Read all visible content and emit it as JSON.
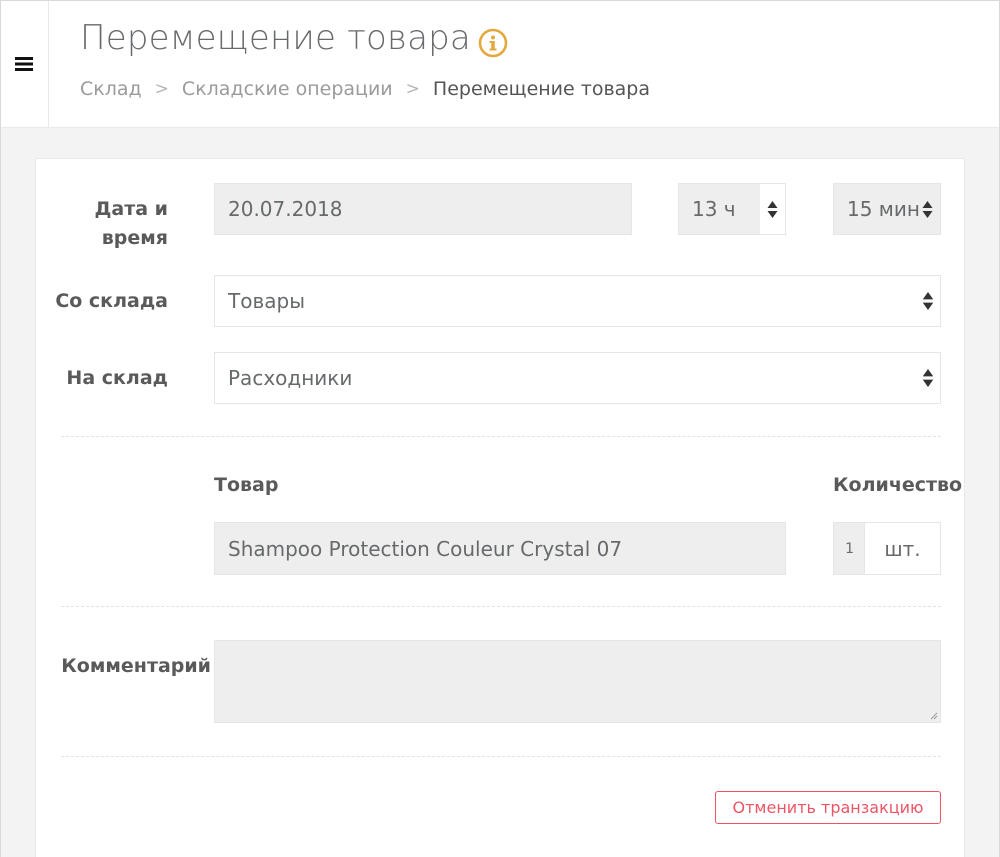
{
  "header": {
    "title": "Перемещение товара",
    "info_icon": "info-circle-icon",
    "menu_icon": "hamburger-menu-icon",
    "breadcrumb": [
      {
        "label": "Склад"
      },
      {
        "label": "Складские операции"
      },
      {
        "label": "Перемещение товара"
      }
    ],
    "breadcrumb_separator": ">"
  },
  "form": {
    "datetime": {
      "label_line1": "Дата и",
      "label_line2": "время",
      "date_value": "20.07.2018",
      "hour_value": "13 ч",
      "minute_value": "15 мин"
    },
    "from_warehouse": {
      "label": "Со склада",
      "value": "Товары"
    },
    "to_warehouse": {
      "label": "На склад",
      "value": "Расходники"
    },
    "items": {
      "product_header": "Товар",
      "quantity_header": "Количество",
      "product_value": "Shampoo Protection Couleur Crystal 07",
      "quantity_value": "1",
      "quantity_unit": "шт."
    },
    "comment": {
      "label": "Комментарий",
      "value": ""
    },
    "cancel_button": "Отменить транзакцию"
  },
  "colors": {
    "accent_orange": "#e3a93d",
    "danger_red": "#ed5565",
    "field_bg": "#eeeeee",
    "page_bg": "#f3f3f4"
  }
}
